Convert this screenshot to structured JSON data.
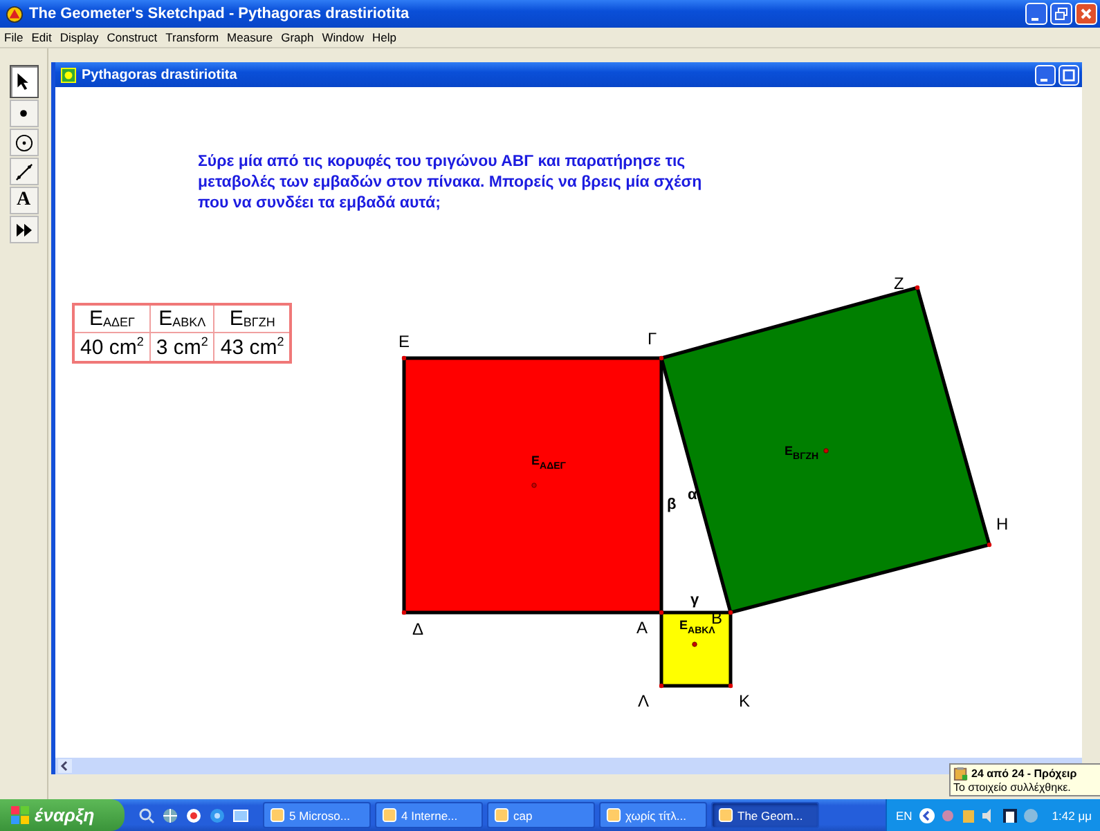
{
  "window": {
    "title": "The Geometer's Sketchpad - Pythagoras drastiriotita"
  },
  "menu": [
    "File",
    "Edit",
    "Display",
    "Construct",
    "Transform",
    "Measure",
    "Graph",
    "Window",
    "Help"
  ],
  "tools": [
    {
      "kind": "arrow",
      "selected": true
    },
    {
      "kind": "point",
      "selected": false
    },
    {
      "kind": "compass",
      "selected": false
    },
    {
      "kind": "line",
      "selected": false
    },
    {
      "kind": "text",
      "glyph": "A",
      "selected": false
    },
    {
      "kind": "custom",
      "selected": false
    }
  ],
  "document": {
    "title": "Pythagoras drastiriotita",
    "instructions": [
      "Σύρε μία από τις κορυφές του τριγώνου ΑΒΓ και παρατήρησε τις",
      "μεταβολές των εμβαδών στον πίνακα. Μπορείς να βρεις μία σχέση",
      "που να συνδέει τα εμβαδά αυτά;"
    ],
    "table": {
      "headers": [
        "Ε$_{ΑΔΕΓ}$",
        "Ε$_{ΑΒΚΛ}$",
        "Ε$_{ΒΓΖΗ}$"
      ],
      "values": [
        "40 cm$^{2}$",
        "3 cm$^{2}$",
        "43 cm$^{2}$"
      ]
    },
    "figure": {
      "squares": [
        {
          "color": "#ff0000",
          "area_label": "Ε$_{ΑΔΕΓ}$"
        },
        {
          "color": "#ffff00",
          "area_label": "Ε$_{ΑΒΚΛ}$"
        },
        {
          "color": "#007f00",
          "area_label": "Ε$_{ΒΓΖΗ}$"
        }
      ],
      "vertices": [
        "Ε",
        "Γ",
        "Δ",
        "Α",
        "Β",
        "Λ",
        "Κ",
        "Ζ",
        "Η"
      ],
      "sides": [
        "α",
        "β",
        "γ"
      ]
    }
  },
  "notification": {
    "title": "24 από 24 - Πρόχειρ",
    "message": "Το στοιχείο συλλέχθηκε."
  },
  "taskbar": {
    "start": "έναρξη",
    "tasks": [
      {
        "label": "5 Microso...",
        "selected": false
      },
      {
        "label": "4 Interne...",
        "selected": false
      },
      {
        "label": "cap",
        "selected": false
      },
      {
        "label": "χωρίς τίτλ...",
        "selected": false
      },
      {
        "label": "The Geom...",
        "selected": true
      }
    ],
    "language": "EN",
    "clock": "1:42 μμ"
  }
}
